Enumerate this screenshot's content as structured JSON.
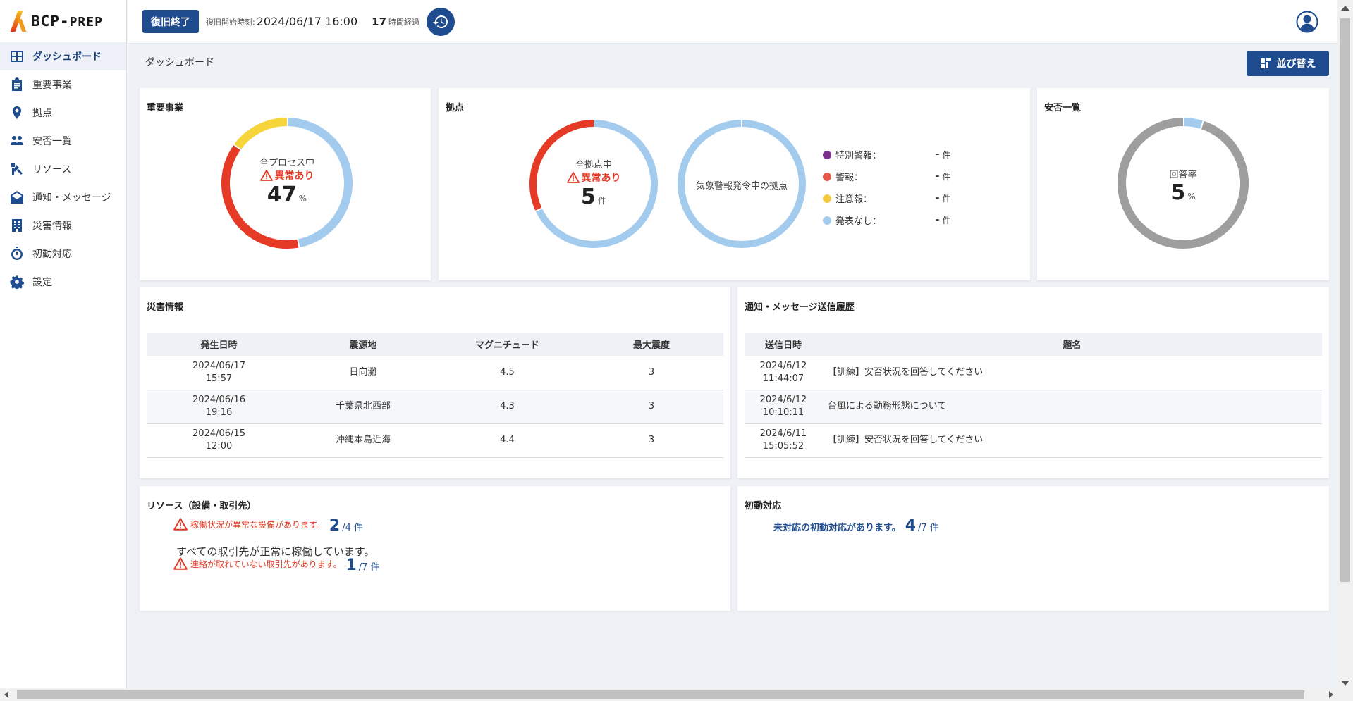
{
  "app": {
    "logo_main": "BCP-",
    "logo_sub": "PREP"
  },
  "sidebar": {
    "items": [
      {
        "label": "ダッシュボード",
        "icon": "dashboard-icon"
      },
      {
        "label": "重要事業",
        "icon": "clipboard-icon"
      },
      {
        "label": "拠点",
        "icon": "location-pin-icon"
      },
      {
        "label": "安否一覧",
        "icon": "people-icon"
      },
      {
        "label": "リソース",
        "icon": "tools-icon"
      },
      {
        "label": "通知・メッセージ",
        "icon": "mail-icon"
      },
      {
        "label": "災害情報",
        "icon": "building-icon"
      },
      {
        "label": "初動対応",
        "icon": "stopwatch-icon"
      },
      {
        "label": "設定",
        "icon": "gear-icon"
      }
    ]
  },
  "topbar": {
    "recovery_end_label": "復旧終了",
    "start_label": "復旧開始時刻:",
    "start_value": "2024/06/17 16:00",
    "hours": "17",
    "hours_unit": "時間経過"
  },
  "page": {
    "title": "ダッシュボード",
    "sort_label": "並び替え"
  },
  "colors": {
    "primary": "#1f4c8f",
    "alert": "#e53a25",
    "warn_yellow": "#f5d53a",
    "calm_blue": "#a3cbee",
    "gray": "#9e9e9e"
  },
  "business": {
    "title": "重要事業",
    "center_label": "全プロセス中",
    "alert_text": "異常あり",
    "percent": "47",
    "unit": "%",
    "ring": [
      {
        "value": 47,
        "color": "#a3cbee"
      },
      {
        "value": 38,
        "color": "#e53a25"
      },
      {
        "value": 15,
        "color": "#f5d53a"
      }
    ]
  },
  "sites": {
    "title": "拠点",
    "center_label": "全拠点中",
    "alert_text": "異常あり",
    "count": "5",
    "unit": "件",
    "ring": [
      {
        "value": 68,
        "color": "#a3cbee"
      },
      {
        "value": 32,
        "color": "#e53a25"
      }
    ],
    "weather_label": "気象警報発令中の拠点",
    "legend": [
      {
        "label": "特別警報：",
        "value": "-",
        "unit": "件",
        "color": "#7b2d8e"
      },
      {
        "label": "警報：",
        "value": "-",
        "unit": "件",
        "color": "#e6584a"
      },
      {
        "label": "注意報：",
        "value": "-",
        "unit": "件",
        "color": "#f5c842"
      },
      {
        "label": "発表なし：",
        "value": "-",
        "unit": "件",
        "color": "#a3cbee"
      }
    ]
  },
  "safety": {
    "title": "安否一覧",
    "center_label": "回答率",
    "percent": "5",
    "unit": "%",
    "ring": [
      {
        "value": 5,
        "color": "#a3cbee"
      },
      {
        "value": 95,
        "color": "#9e9e9e"
      }
    ]
  },
  "disaster": {
    "title": "災害情報",
    "headers": [
      "発生日時",
      "震源地",
      "マグニチュード",
      "最大震度"
    ],
    "rows": [
      {
        "date": "2024/06/17",
        "time": "15:57",
        "place": "日向灘",
        "mag": "4.5",
        "intensity": "3"
      },
      {
        "date": "2024/06/16",
        "time": "19:16",
        "place": "千葉県北西部",
        "mag": "4.3",
        "intensity": "3"
      },
      {
        "date": "2024/06/15",
        "time": "12:00",
        "place": "沖縄本島近海",
        "mag": "4.4",
        "intensity": "3"
      }
    ]
  },
  "messages": {
    "title": "通知・メッセージ送信履歴",
    "headers": [
      "送信日時",
      "題名"
    ],
    "rows": [
      {
        "date": "2024/6/12",
        "time": "11:44:07",
        "subject": "【訓練】安否状況を回答してください"
      },
      {
        "date": "2024/6/12",
        "time": "10:10:11",
        "subject": "台風による勤務形態について"
      },
      {
        "date": "2024/6/11",
        "time": "15:05:52",
        "subject": "【訓練】安否状況を回答してください"
      }
    ]
  },
  "resources": {
    "title": "リソース（設備・取引先）",
    "equipment_alert": "稼働状況が異常な設備があります。",
    "equipment_count": "2",
    "equipment_total": "/4 件",
    "partner_ok": "すべての取引先が正常に稼働しています。",
    "partner_alert": "連絡が取れていない取引先があります。",
    "partner_count": "1",
    "partner_total": "/7 件"
  },
  "initial": {
    "title": "初動対応",
    "text": "未対応の初動対応があります。",
    "count": "4",
    "total": "/7 件"
  }
}
